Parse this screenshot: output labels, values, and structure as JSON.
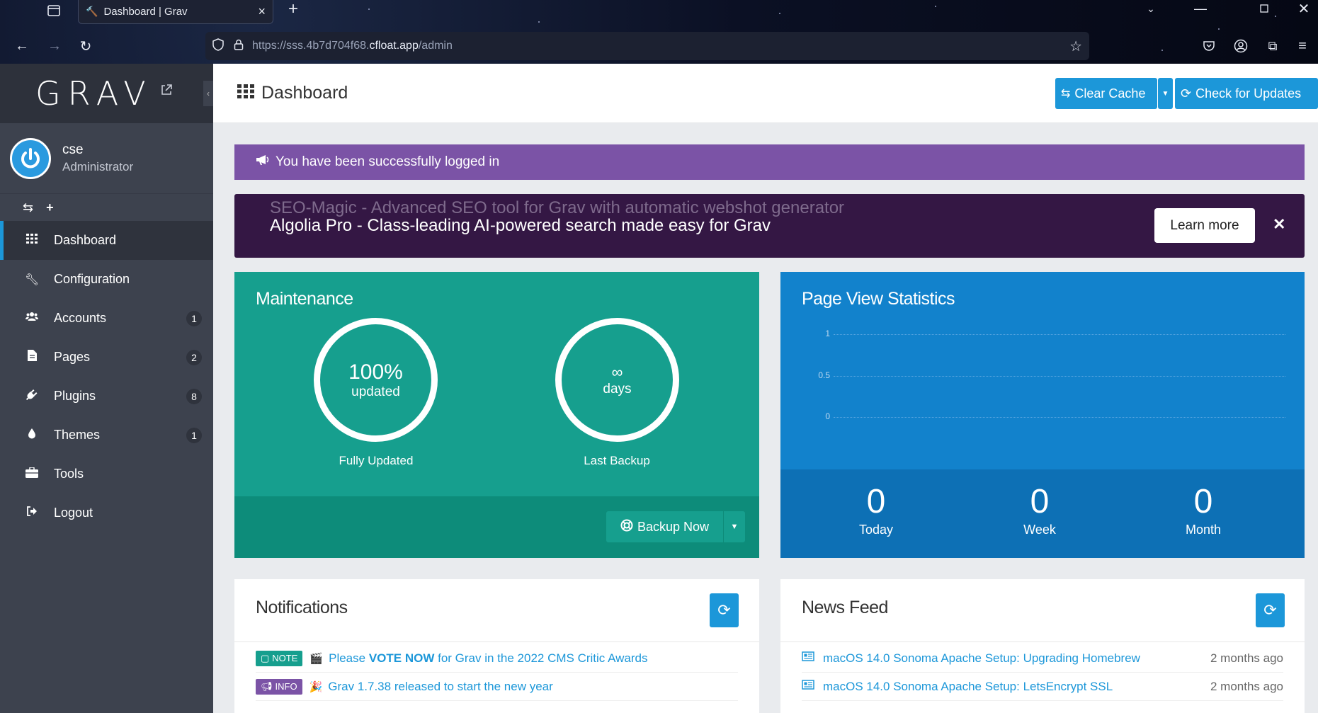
{
  "browser": {
    "tab_title": "Dashboard | Grav",
    "url_prefix": "https://sss.4b7d704f68.",
    "url_host": "cfloat.app",
    "url_path": "/admin"
  },
  "sidebar": {
    "logo": "GRAV",
    "user": {
      "name": "cse",
      "role": "Administrator"
    },
    "items": [
      {
        "label": "Dashboard",
        "icon": "grid-icon",
        "badge": ""
      },
      {
        "label": "Configuration",
        "icon": "wrench-icon",
        "badge": ""
      },
      {
        "label": "Accounts",
        "icon": "users-icon",
        "badge": "1"
      },
      {
        "label": "Pages",
        "icon": "file-icon",
        "badge": "2"
      },
      {
        "label": "Plugins",
        "icon": "plug-icon",
        "badge": "8"
      },
      {
        "label": "Themes",
        "icon": "tint-icon",
        "badge": "1"
      },
      {
        "label": "Tools",
        "icon": "briefcase-icon",
        "badge": ""
      },
      {
        "label": "Logout",
        "icon": "sign-out-icon",
        "badge": ""
      }
    ]
  },
  "header": {
    "title": "Dashboard",
    "clear_cache": "Clear Cache",
    "check_updates": "Check for Updates"
  },
  "alert": {
    "text": "You have been successfully logged in"
  },
  "promo": {
    "line1": "SEO-Magic - Advanced SEO tool for Grav with automatic webshot generator",
    "line2": "Algolia Pro - Class-leading AI-powered search made easy for Grav",
    "button": "Learn more"
  },
  "maintenance": {
    "title": "Maintenance",
    "updated_value": "100%",
    "updated_unit": "updated",
    "updated_label": "Fully Updated",
    "backup_value": "∞",
    "backup_unit": "days",
    "backup_label": "Last Backup",
    "backup_button": "Backup Now"
  },
  "page_views": {
    "title": "Page View Statistics",
    "y_ticks": [
      "1",
      "0.5",
      "0"
    ],
    "stats": [
      {
        "value": "0",
        "label": "Today"
      },
      {
        "value": "0",
        "label": "Week"
      },
      {
        "value": "0",
        "label": "Month"
      }
    ]
  },
  "notifications": {
    "title": "Notifications",
    "items": [
      {
        "tag": "NOTE",
        "emoji": "🎬",
        "pre": "Please ",
        "bold": "VOTE NOW",
        "post": " for Grav in the 2022 CMS Critic Awards"
      },
      {
        "tag": "INFO",
        "emoji": "🎉",
        "pre": "Grav 1.7.38 released to start the new year",
        "bold": "",
        "post": ""
      }
    ]
  },
  "news": {
    "title": "News Feed",
    "items": [
      {
        "title": "macOS 14.0 Sonoma Apache Setup: Upgrading Homebrew",
        "date": "2 months ago"
      },
      {
        "title": "macOS 14.0 Sonoma Apache Setup: LetsEncrypt SSL",
        "date": "2 months ago"
      }
    ]
  }
}
